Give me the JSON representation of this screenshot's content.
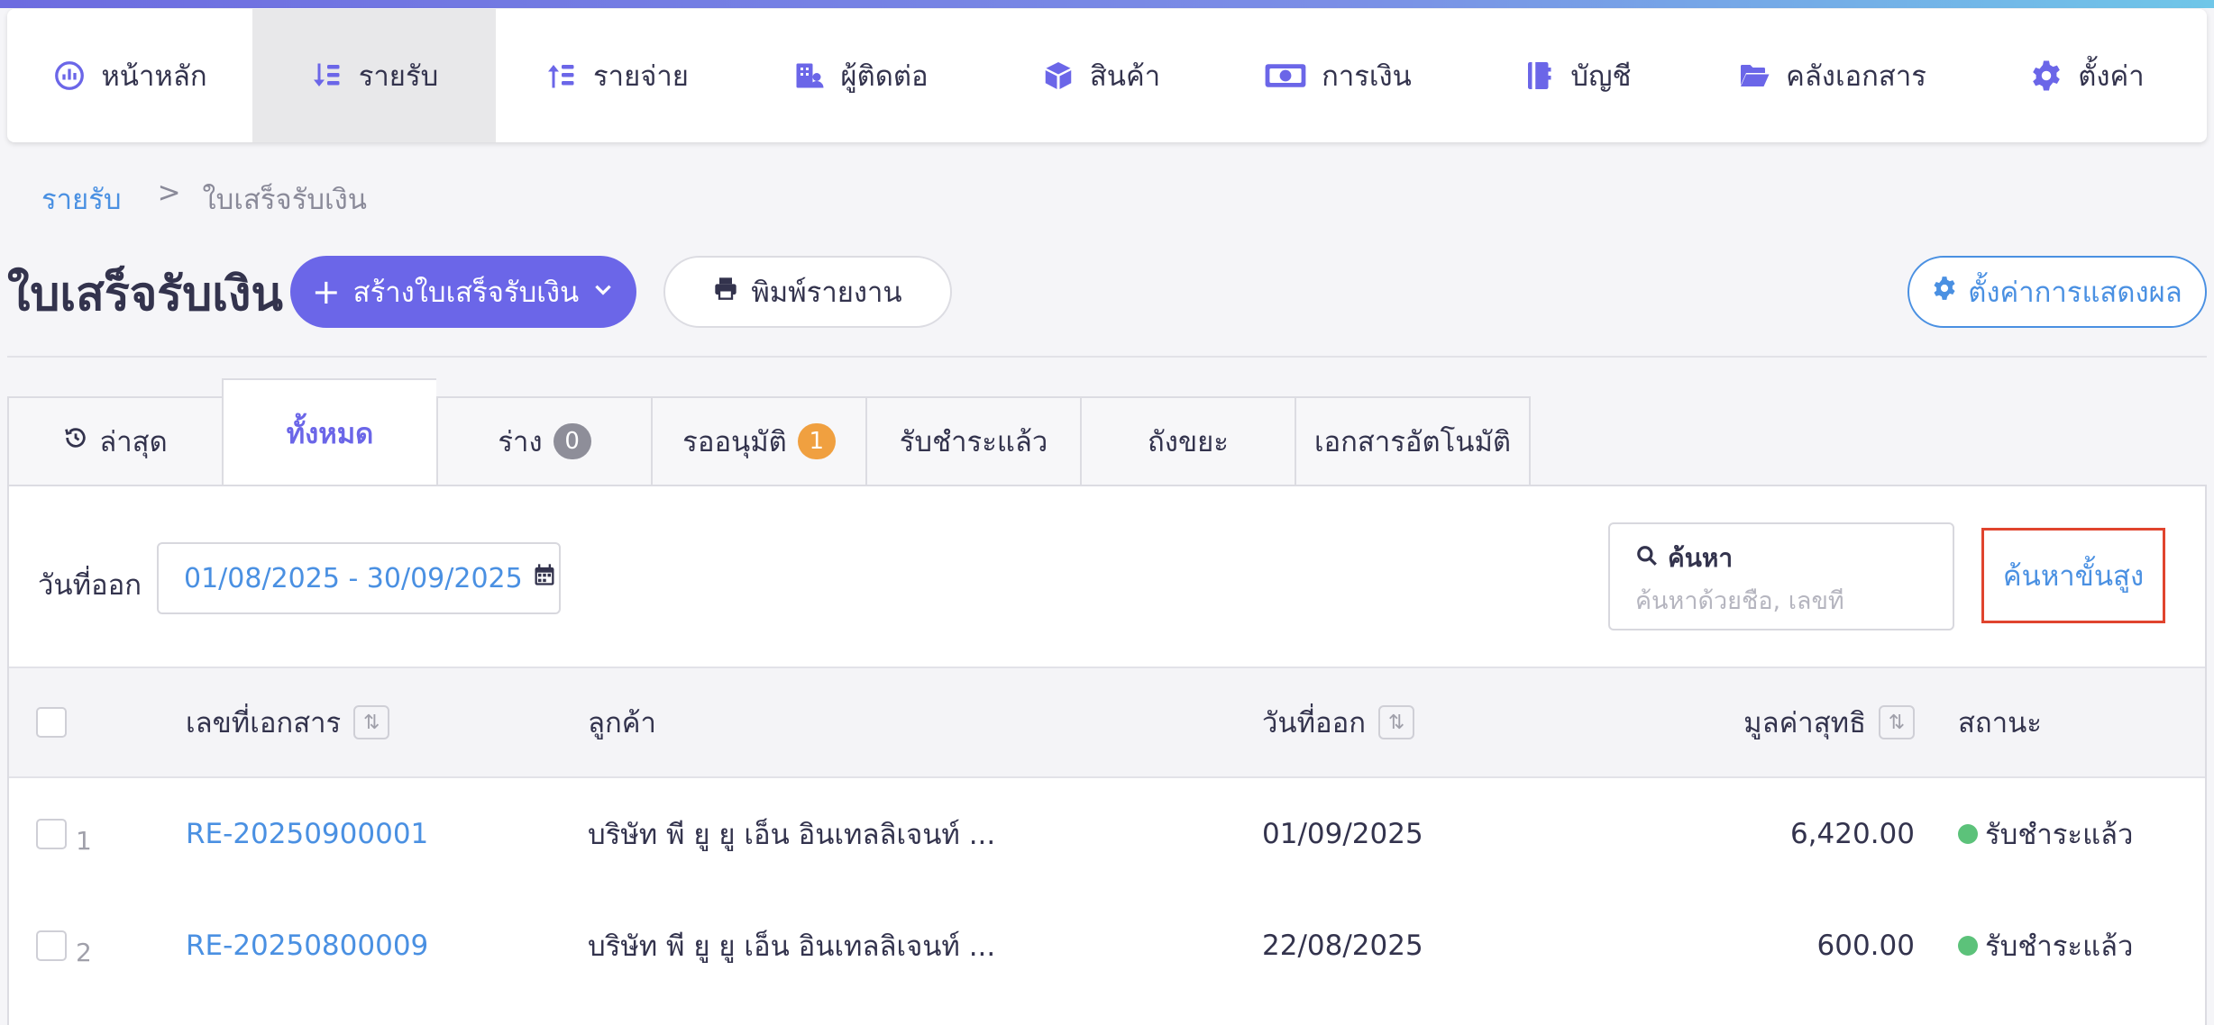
{
  "nav": {
    "items": [
      {
        "label": "หน้าหลัก",
        "icon": "dashboard-icon"
      },
      {
        "label": "รายรับ",
        "icon": "income-icon",
        "active": true
      },
      {
        "label": "รายจ่าย",
        "icon": "expense-icon"
      },
      {
        "label": "ผู้ติดต่อ",
        "icon": "contacts-icon"
      },
      {
        "label": "สินค้า",
        "icon": "box-icon"
      },
      {
        "label": "การเงิน",
        "icon": "money-icon"
      },
      {
        "label": "บัญชี",
        "icon": "ledger-icon"
      },
      {
        "label": "คลังเอกสาร",
        "icon": "folder-icon"
      },
      {
        "label": "ตั้งค่า",
        "icon": "gear-icon"
      }
    ]
  },
  "breadcrumb": {
    "parent": "รายรับ",
    "separator": ">",
    "current": "ใบเสร็จรับเงิน"
  },
  "page": {
    "title": "ใบเสร็จรับเงิน",
    "create_label": "สร้างใบเสร็จรับเงิน",
    "print_label": "พิมพ์รายงาน",
    "settings_label": "ตั้งค่าการแสดงผล"
  },
  "tabs": [
    {
      "label": "ล่าสุด"
    },
    {
      "label": "ทั้งหมด",
      "active": true
    },
    {
      "label": "ร่าง",
      "badge": "0"
    },
    {
      "label": "รออนุมัติ",
      "badge": "1"
    },
    {
      "label": "รับชำระแล้ว"
    },
    {
      "label": "ถังขยะ"
    },
    {
      "label": "เอกสารอัตโนมัติ"
    }
  ],
  "filters": {
    "date_label": "วันที่ออก",
    "date_range": "01/08/2025 - 30/09/2025",
    "search_title": "ค้นหา",
    "search_placeholder": "ค้นหาด้วยชื่อ, เลขที่",
    "advanced_label": "ค้นหาขั้นสูง"
  },
  "table": {
    "columns": {
      "doc_no": "เลขที่เอกสาร",
      "customer": "ลูกค้า",
      "date": "วันที่ออก",
      "amount": "มูลค่าสุทธิ",
      "status": "สถานะ"
    },
    "rows": [
      {
        "num": "1",
        "doc_no": "RE-20250900001",
        "customer": "บริษัท พี ยู ยู เอ็น อินเทลลิเจนท์ ...",
        "date": "01/09/2025",
        "amount": "6,420.00",
        "status": "รับชำระแล้ว"
      },
      {
        "num": "2",
        "doc_no": "RE-20250800009",
        "customer": "บริษัท พี ยู ยู เอ็น อินเทลลิเจนท์ ...",
        "date": "22/08/2025",
        "amount": "600.00",
        "status": "รับชำระแล้ว"
      }
    ]
  },
  "colors": {
    "accent": "#6b66e8",
    "link": "#4a90e2",
    "highlight": "#e0442e",
    "paid": "#5cc27a"
  }
}
